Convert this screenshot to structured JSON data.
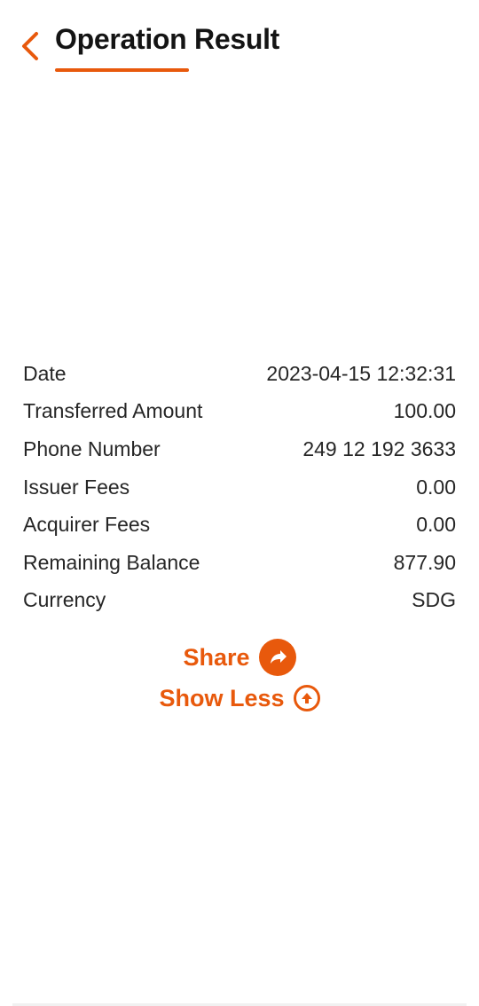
{
  "header": {
    "title": "Operation Result",
    "back_icon": "chevron-left-icon"
  },
  "details": [
    {
      "label": "Date",
      "value": "2023-04-15 12:32:31"
    },
    {
      "label": "Transferred Amount",
      "value": "100.00"
    },
    {
      "label": "Phone Number",
      "value": "249 12 192 3633"
    },
    {
      "label": "Issuer Fees",
      "value": "0.00"
    },
    {
      "label": "Acquirer Fees",
      "value": "0.00"
    },
    {
      "label": "Remaining Balance",
      "value": "877.90"
    },
    {
      "label": "Currency",
      "value": "SDG"
    }
  ],
  "actions": {
    "share_label": "Share",
    "share_icon": "share-icon",
    "show_less_label": "Show Less",
    "show_less_icon": "arrow-up-circle-icon"
  },
  "colors": {
    "accent": "#e8590c",
    "text": "#262626",
    "background": "#ffffff"
  }
}
